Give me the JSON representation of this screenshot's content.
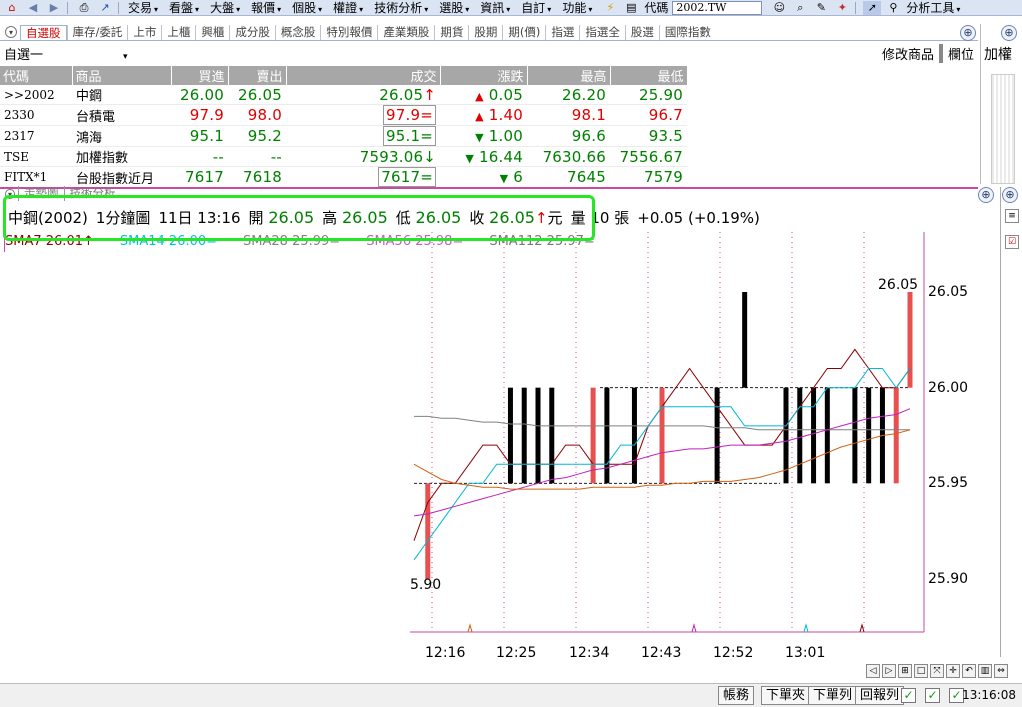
{
  "menu": {
    "items": [
      "交易",
      "看盤",
      "大盤",
      "報價",
      "個股",
      "權證",
      "技術分析",
      "選股",
      "資訊",
      "自訂",
      "功能"
    ],
    "code_label": "代碼",
    "code_value": "2002.TW",
    "analysis_tools": "分析工具"
  },
  "tabs": [
    "自選股",
    "庫存/委託",
    "上市",
    "上櫃",
    "興櫃",
    "成分股",
    "概念股",
    "特別報價",
    "產業類股",
    "期貨",
    "股期",
    "期(價)",
    "指選",
    "指選全",
    "股選",
    "國際指數"
  ],
  "watchlist": {
    "selected": "自選一",
    "modify_btn": "修改商品",
    "fields_btn": "欄位"
  },
  "right_panel": {
    "title": "加權"
  },
  "quotes": {
    "headers": [
      "代碼",
      "商品",
      "買進",
      "賣出",
      "成交",
      "漲跌",
      "最高",
      "最低"
    ],
    "rows": [
      {
        "code": ">>2002",
        "name": "中鋼",
        "bid": "26.00",
        "ask": "26.05",
        "last": "26.05",
        "last_mark": "↑",
        "dir": "up",
        "change": "0.05",
        "high": "26.20",
        "low": "25.90",
        "color": "dn"
      },
      {
        "code": "2330",
        "name": "台積電",
        "bid": "97.9",
        "ask": "98.0",
        "last": "97.9",
        "last_mark": "=",
        "dir": "up",
        "change": "1.40",
        "high": "98.1",
        "low": "96.7",
        "color": "up"
      },
      {
        "code": "2317",
        "name": "鴻海",
        "bid": "95.1",
        "ask": "95.2",
        "last": "95.1",
        "last_mark": "=",
        "dir": "dn",
        "change": "1.00",
        "high": "96.6",
        "low": "93.5",
        "color": "dn"
      },
      {
        "code": "TSE",
        "name": "加權指數",
        "bid": "--",
        "ask": "--",
        "last": "7593.06",
        "last_mark": "↓",
        "dir": "dn",
        "change": "16.44",
        "high": "7630.66",
        "low": "7556.67",
        "color": "dn"
      },
      {
        "code": "FITX*1",
        "name": "台股指數近月",
        "bid": "7617",
        "ask": "7618",
        "last": "7617",
        "last_mark": "=",
        "dir": "dn",
        "change": "6",
        "high": "7645",
        "low": "7579",
        "color": "dn"
      }
    ]
  },
  "chart_tabs": [
    "走勢圖",
    "技術分析"
  ],
  "info": {
    "symbol": "中鋼(2002)",
    "period": "1分鐘圖",
    "datetime": "11日 13:16",
    "open_label": "開",
    "open": "26.05",
    "high_label": "高",
    "high": "26.05",
    "low_label": "低",
    "low": "26.05",
    "close_label": "收",
    "close": "26.05",
    "close_mark": "↑",
    "unit": "元",
    "volume_label": "量",
    "volume": "10",
    "volume_unit": "張",
    "change": "+0.05 (+0.19%)"
  },
  "ma_legend": {
    "ma7": "SMA7 26.01↑",
    "ma14": "SMA14 26.00=",
    "ma28": "SMA28 25.99=",
    "ma56": "SMA56 25.98=",
    "ma112": "SMA112 25.97="
  },
  "chart_data": {
    "type": "line",
    "title": "",
    "ylim": [
      25.87,
      26.08
    ],
    "yticks": [
      "26.05",
      "26.00",
      "25.95",
      "25.90"
    ],
    "xticks": [
      "12:16",
      "12:25",
      "12:34",
      "12:43",
      "12:52",
      "13:01"
    ],
    "peak_label": "26.05",
    "trough_label": "5.90",
    "series": [
      {
        "name": "SMA7",
        "color": "#8b0000",
        "values": [
          25.92,
          25.94,
          25.95,
          25.95,
          25.96,
          25.97,
          25.97,
          25.96,
          25.96,
          25.96,
          25.96,
          25.97,
          25.97,
          25.96,
          25.96,
          25.96,
          25.96,
          25.98,
          25.99,
          26.0,
          26.01,
          26.0,
          25.99,
          25.98,
          25.97,
          25.97,
          25.97,
          25.98,
          25.99,
          26.0,
          26.01,
          26.01,
          26.02,
          26.01,
          26.0,
          26.0,
          26.01
        ]
      },
      {
        "name": "SMA14",
        "color": "#00b8d8",
        "values": [
          25.91,
          25.92,
          25.93,
          25.94,
          25.95,
          25.95,
          25.96,
          25.96,
          25.96,
          25.96,
          25.96,
          25.96,
          25.96,
          25.96,
          25.96,
          25.97,
          25.97,
          25.98,
          25.99,
          25.99,
          25.99,
          25.99,
          25.99,
          25.99,
          25.98,
          25.98,
          25.98,
          25.98,
          25.99,
          25.99,
          26.0,
          26.0,
          26.0,
          26.01,
          26.01,
          26.0,
          26.01
        ]
      },
      {
        "name": "SMA28",
        "color": "#808080",
        "values": [
          25.985,
          25.985,
          25.984,
          25.984,
          25.983,
          25.982,
          25.982,
          25.981,
          25.981,
          25.98,
          25.98,
          25.98,
          25.98,
          25.98,
          25.98,
          25.98,
          25.98,
          25.98,
          25.98,
          25.98,
          25.98,
          25.98,
          25.979,
          25.979,
          25.979,
          25.978,
          25.978,
          25.978,
          25.978,
          25.978,
          25.978,
          25.978,
          25.978,
          25.978,
          25.978,
          25.978,
          25.978
        ]
      },
      {
        "name": "SMA56",
        "color": "#c020c0",
        "values": [
          25.933,
          25.934,
          25.936,
          25.938,
          25.94,
          25.942,
          25.944,
          25.946,
          25.948,
          25.95,
          25.952,
          25.953,
          25.955,
          25.957,
          25.958,
          25.96,
          25.962,
          25.964,
          25.966,
          25.967,
          25.968,
          25.968,
          25.969,
          25.97,
          25.97,
          25.97,
          25.971,
          25.972,
          25.974,
          25.976,
          25.978,
          25.98,
          25.982,
          25.984,
          25.985,
          25.986,
          25.989
        ]
      },
      {
        "name": "SMA112",
        "color": "#d06010",
        "values": [
          25.96,
          25.956,
          25.952,
          25.95,
          25.949,
          25.948,
          25.948,
          25.947,
          25.947,
          25.947,
          25.947,
          25.947,
          25.947,
          25.948,
          25.948,
          25.948,
          25.948,
          25.949,
          25.949,
          25.95,
          25.95,
          25.951,
          25.951,
          25.951,
          25.952,
          25.953,
          25.955,
          25.957,
          25.96,
          25.963,
          25.966,
          25.969,
          25.971,
          25.973,
          25.975,
          25.976,
          25.978
        ]
      }
    ],
    "bars": [
      {
        "i": 1,
        "lo": 25.9,
        "hi": 25.95,
        "color": "red"
      },
      {
        "i": 7,
        "lo": 25.95,
        "hi": 26.0,
        "color": "black"
      },
      {
        "i": 8,
        "lo": 25.95,
        "hi": 26.0,
        "color": "black"
      },
      {
        "i": 9,
        "lo": 25.95,
        "hi": 26.0,
        "color": "black"
      },
      {
        "i": 10,
        "lo": 25.95,
        "hi": 26.0,
        "color": "black"
      },
      {
        "i": 13,
        "lo": 25.95,
        "hi": 26.0,
        "color": "red"
      },
      {
        "i": 14,
        "lo": 25.95,
        "hi": 26.0,
        "color": "black"
      },
      {
        "i": 16,
        "lo": 25.95,
        "hi": 26.0,
        "color": "black"
      },
      {
        "i": 18,
        "lo": 25.95,
        "hi": 26.0,
        "color": "red"
      },
      {
        "i": 22,
        "lo": 25.95,
        "hi": 26.0,
        "color": "black"
      },
      {
        "i": 24,
        "lo": 26.0,
        "hi": 26.05,
        "color": "black"
      },
      {
        "i": 27,
        "lo": 25.95,
        "hi": 26.0,
        "color": "black"
      },
      {
        "i": 28,
        "lo": 25.95,
        "hi": 26.0,
        "color": "black"
      },
      {
        "i": 29,
        "lo": 25.95,
        "hi": 26.0,
        "color": "black"
      },
      {
        "i": 30,
        "lo": 25.95,
        "hi": 26.0,
        "color": "black"
      },
      {
        "i": 32,
        "lo": 25.95,
        "hi": 26.0,
        "color": "black"
      },
      {
        "i": 33,
        "lo": 25.95,
        "hi": 26.0,
        "color": "black"
      },
      {
        "i": 34,
        "lo": 25.95,
        "hi": 26.0,
        "color": "black"
      },
      {
        "i": 35,
        "lo": 25.95,
        "hi": 26.0,
        "color": "red"
      },
      {
        "i": 36,
        "lo": 26.0,
        "hi": 26.05,
        "color": "red"
      }
    ]
  },
  "status": {
    "buttons": [
      "帳務",
      "下單夾",
      "下單列",
      "回報列"
    ],
    "clock": "13:16:08"
  }
}
